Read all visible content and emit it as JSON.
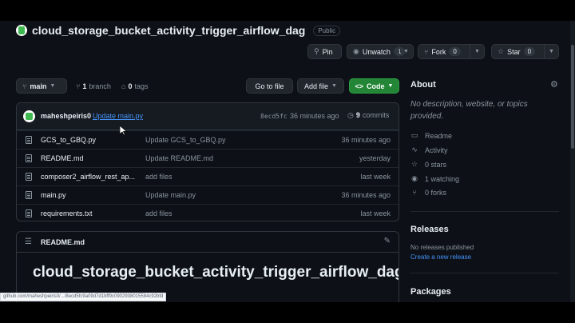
{
  "repo": {
    "name": "cloud_storage_bucket_activity_trigger_airflow_dag",
    "visibility": "Public"
  },
  "actions": {
    "pin": "Pin",
    "unwatch": "Unwatch",
    "unwatch_count": "1",
    "fork": "Fork",
    "fork_count": "0",
    "star": "Star",
    "star_count": "0"
  },
  "toolbar": {
    "branch": "main",
    "branches_count": "1",
    "branches_label": "branch",
    "tags_count": "0",
    "tags_label": "tags",
    "go_to_file": "Go to file",
    "add_file": "Add file",
    "code": "Code"
  },
  "commit": {
    "author": "maheshpeiris0",
    "message": "Update main.py",
    "sha": "8ecd5fc",
    "time": "36 minutes ago",
    "commits_count": "9",
    "commits_label": "commits"
  },
  "files": [
    {
      "name": "GCS_to_GBQ.py",
      "message": "Update GCS_to_GBQ.py",
      "time": "36 minutes ago"
    },
    {
      "name": "README.md",
      "message": "Update README.md",
      "time": "yesterday"
    },
    {
      "name": "composer2_airflow_rest_ap...",
      "message": "add files",
      "time": "last week"
    },
    {
      "name": "main.py",
      "message": "Update main.py",
      "time": "36 minutes ago"
    },
    {
      "name": "requirements.txt",
      "message": "add files",
      "time": "last week"
    }
  ],
  "readme": {
    "header": "README.md",
    "heading": "cloud_storage_bucket_activity_trigger_airflow_dag"
  },
  "about": {
    "title": "About",
    "description": "No description, website, or topics provided.",
    "readme": "Readme",
    "activity": "Activity",
    "stars": "0 stars",
    "watching": "1 watching",
    "forks": "0 forks"
  },
  "releases": {
    "title": "Releases",
    "none": "No releases published",
    "create": "Create a new release"
  },
  "packages": {
    "title": "Packages"
  },
  "status_bar": {
    "url": "github.com/maheshpeiris0/.../8ecd5fc9a09d7d1bff9c0902938015584c92bfd"
  },
  "colors": {
    "background": "#0d1117",
    "border": "#30363d",
    "button": "#21262d",
    "code_button": "#238636",
    "link": "#4493f8"
  }
}
